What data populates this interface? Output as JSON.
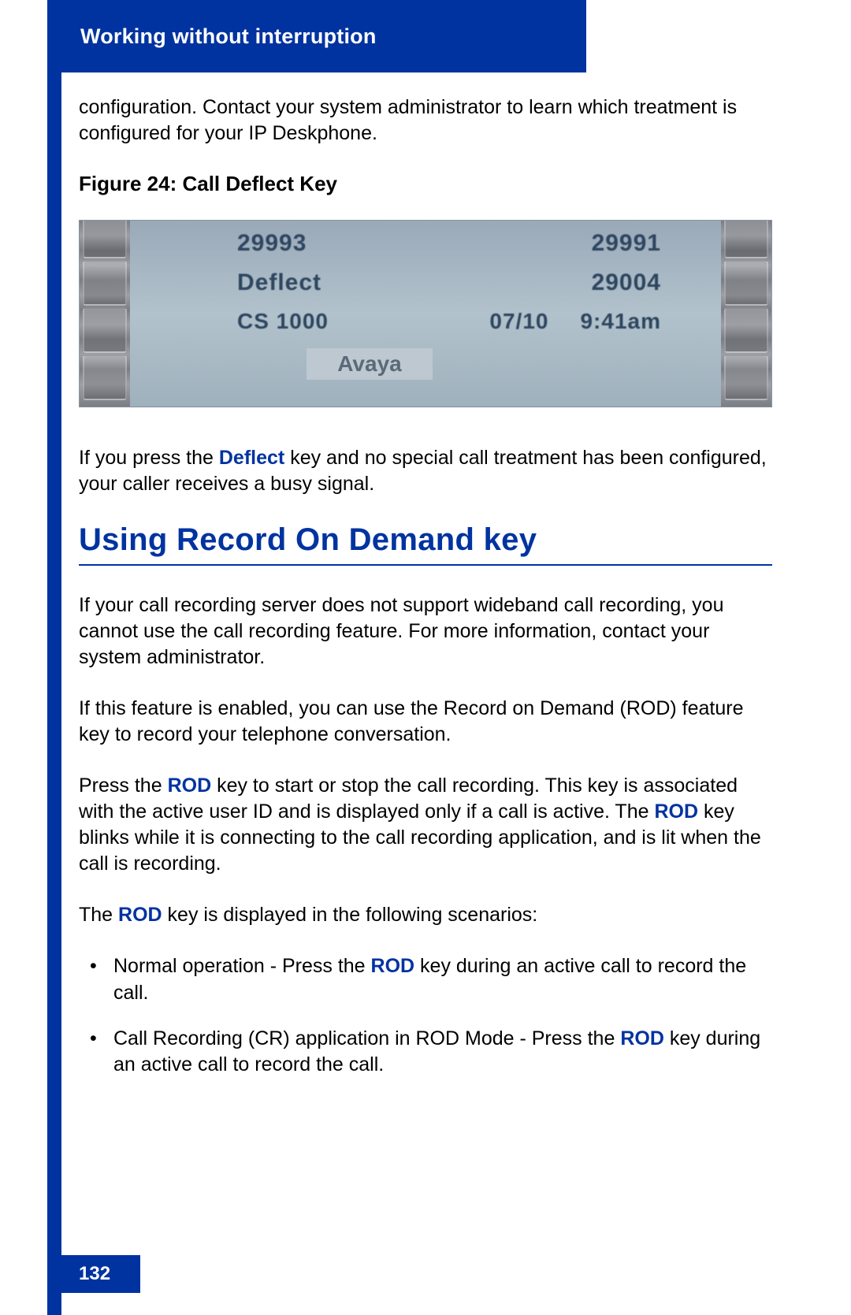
{
  "header": {
    "title": "Working without interruption"
  },
  "page_number": "132",
  "colors": {
    "brand_blue": "#0033a0"
  },
  "intro_paragraph": "configuration. Contact your system administrator to learn which treatment is configured for your IP Deskphone.",
  "figure": {
    "caption": "Figure 24: Call Deflect Key",
    "screen": {
      "row1_left": "29993",
      "row1_right": "29991",
      "row2_left": "Deflect",
      "row2_right": "29004",
      "row3_left": "CS 1000",
      "row3_date": "07/10",
      "row3_time": "9:41am",
      "brand_overlay": "Avaya"
    }
  },
  "deflect_note": {
    "before": "If you press the ",
    "key": "Deflect",
    "after": " key and no special call treatment has been configured, your caller receives a busy signal."
  },
  "section_title": "Using Record On Demand key",
  "rod_para1": "If your call recording server does not support wideband call recording, you cannot use the call recording feature. For more information, contact your system administrator.",
  "rod_para2": "If this feature is enabled, you can use the Record on Demand (ROD) feature key to record your telephone conversation.",
  "rod_para3": {
    "p1": "Press the ",
    "k1": "ROD",
    "p2": " key to start or stop the call recording. This key is associated with the active user ID and is displayed only if a call is active. The ",
    "k2": "ROD",
    "p3": " key blinks while it is connecting to the call recording application, and is lit when the call is recording."
  },
  "rod_para4": {
    "p1": "The ",
    "k1": "ROD",
    "p2": " key is displayed in the following scenarios:"
  },
  "bullets": [
    {
      "p1": "Normal operation - Press the ",
      "k1": "ROD",
      "p2": " key during an active call to record the call."
    },
    {
      "p1": "Call Recording (CR) application in ROD Mode - Press the ",
      "k1": "ROD",
      "p2": " key during an active call to record the call."
    }
  ]
}
